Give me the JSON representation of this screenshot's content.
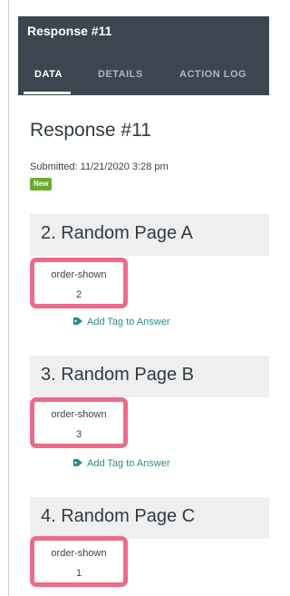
{
  "header": {
    "title": "Response #11",
    "tabs": [
      {
        "label": "DATA",
        "active": true
      },
      {
        "label": "DETAILS",
        "active": false
      },
      {
        "label": "ACTION LOG",
        "active": false
      }
    ]
  },
  "main": {
    "title": "Response #11",
    "submitted": "Submitted: 11/21/2020 3:28 pm",
    "badge": "New",
    "sections": [
      {
        "title": "2. Random Page A",
        "field_label": "order-shown",
        "field_value": "2",
        "tag_link": "Add Tag to Answer"
      },
      {
        "title": "3. Random Page B",
        "field_label": "order-shown",
        "field_value": "3",
        "tag_link": "Add Tag to Answer"
      },
      {
        "title": "4. Random Page C",
        "field_label": "order-shown",
        "field_value": "1"
      }
    ]
  },
  "colors": {
    "header_bg": "#3b4650",
    "highlight": "#ee6a8a",
    "badge": "#6aac2e",
    "link": "#2e8a8d"
  },
  "icons": {
    "tag": "tag-icon"
  }
}
